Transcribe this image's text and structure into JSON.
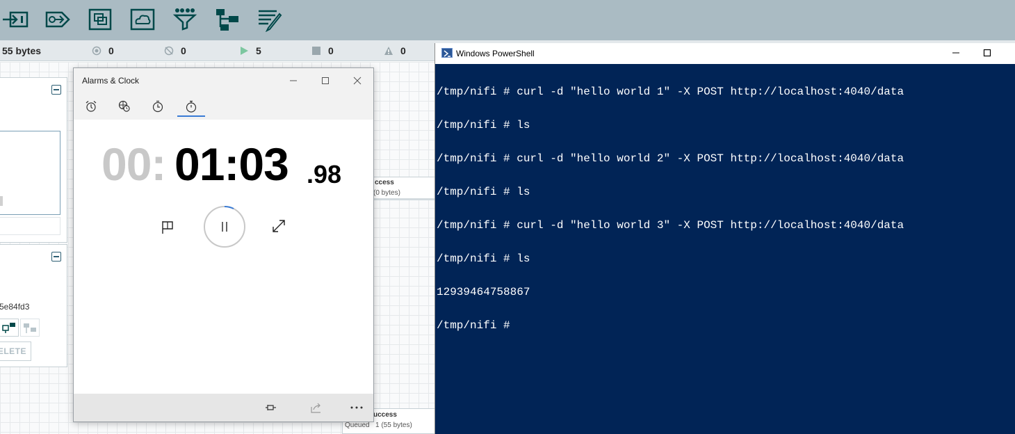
{
  "nifi": {
    "toolbar_icons": [
      "input-port-icon",
      "output-port-icon",
      "process-group-icon",
      "remote-process-group-icon",
      "funnel-icon",
      "template-icon",
      "label-icon"
    ],
    "status": {
      "bytes": "55 bytes",
      "transmitting": "0",
      "not_transmitting": "0",
      "running": "5",
      "stopped": "0",
      "invalid": "0"
    },
    "panel_id": "5e84fd3",
    "delete_label": "DELETE",
    "connection_top": {
      "name": "ccess",
      "queued": "(0 bytes)"
    },
    "connection_bottom": {
      "name": "uccess",
      "queued_label": "Queued",
      "queued_value": "1 (55 bytes)"
    }
  },
  "clock": {
    "title": "Alarms & Clock",
    "tabs": [
      "alarm-tab",
      "world-clock-tab",
      "timer-tab",
      "stopwatch-tab"
    ],
    "stopwatch": {
      "hours": "00:",
      "main": "01:03",
      "fraction": ".98"
    }
  },
  "powershell": {
    "title": "Windows PowerShell",
    "lines": [
      "/tmp/nifi # curl -d \"hello world 1\" -X POST http://localhost:4040/data",
      "/tmp/nifi # ls",
      "/tmp/nifi # curl -d \"hello world 2\" -X POST http://localhost:4040/data",
      "/tmp/nifi # ls",
      "/tmp/nifi # curl -d \"hello world 3\" -X POST http://localhost:4040/data",
      "/tmp/nifi # ls",
      "12939464758867",
      "/tmp/nifi # "
    ]
  },
  "colors": {
    "nifi_toolbar": "#aabbc3",
    "nifi_icon": "#004849",
    "ps_background": "#012456",
    "accent": "#3a7bd5"
  }
}
